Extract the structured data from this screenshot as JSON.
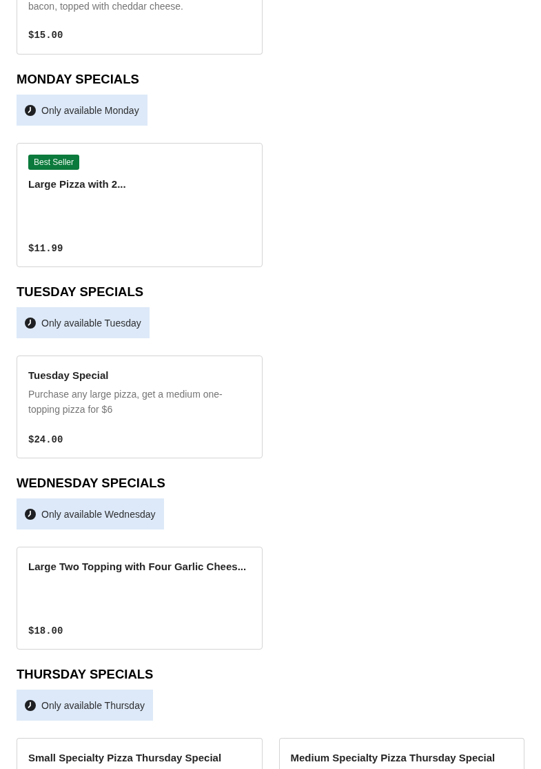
{
  "menu_fragment": {
    "description": "bacon, topped with cheddar cheese.",
    "price": "$15.00"
  },
  "sections": [
    {
      "heading": "MONDAY SPECIALS",
      "availability": "Only available Monday",
      "items": [
        {
          "badge": "Best Seller",
          "title": "Large Pizza with 2...",
          "price": "$11.99"
        }
      ]
    },
    {
      "heading": "TUESDAY SPECIALS",
      "availability": "Only available Tuesday",
      "items": [
        {
          "title": "Tuesday Special",
          "description": "Purchase any large pizza, get a medium one-topping pizza for $6",
          "price": "$24.00"
        }
      ]
    },
    {
      "heading": "WEDNESDAY SPECIALS",
      "availability": "Only available Wednesday",
      "items": [
        {
          "title": "Large Two Topping with Four Garlic Chees...",
          "price": "$18.00"
        }
      ]
    },
    {
      "heading": "THURSDAY SPECIALS",
      "availability": "Only available Thursday",
      "items": [
        {
          "title": "Small Specialty Pizza Thursday Special"
        },
        {
          "title": "Medium Specialty Pizza Thursday Special"
        }
      ]
    }
  ]
}
